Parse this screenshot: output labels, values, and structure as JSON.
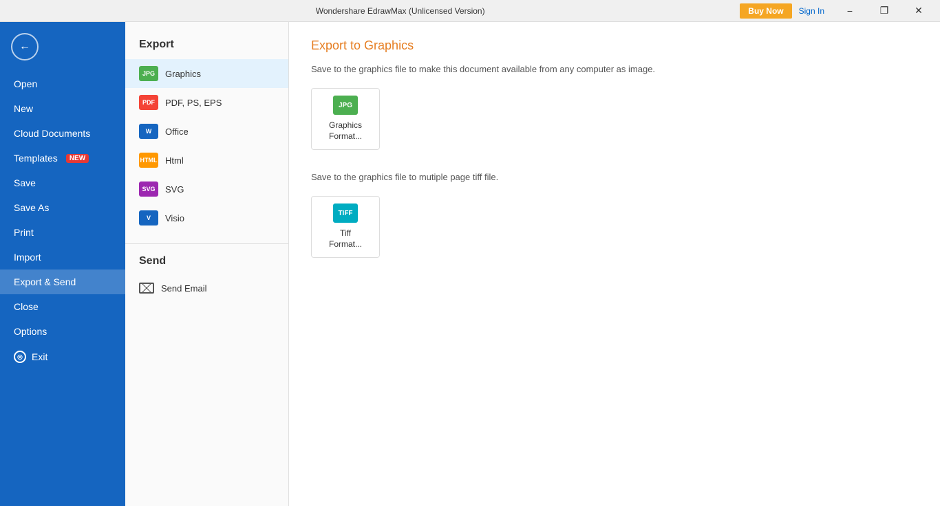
{
  "titlebar": {
    "title": "Wondershare EdrawMax (Unlicensed Version)",
    "buy_now": "Buy Now",
    "sign_in": "Sign In",
    "minimize": "−",
    "restore": "❐",
    "close": "✕"
  },
  "sidebar": {
    "items": [
      {
        "id": "open",
        "label": "Open",
        "badge": null
      },
      {
        "id": "new",
        "label": "New",
        "badge": null
      },
      {
        "id": "cloud-documents",
        "label": "Cloud Documents",
        "badge": null
      },
      {
        "id": "templates",
        "label": "Templates",
        "badge": "NEW"
      },
      {
        "id": "save",
        "label": "Save",
        "badge": null
      },
      {
        "id": "save-as",
        "label": "Save As",
        "badge": null
      },
      {
        "id": "print",
        "label": "Print",
        "badge": null
      },
      {
        "id": "import",
        "label": "Import",
        "badge": null
      },
      {
        "id": "export-send",
        "label": "Export & Send",
        "badge": null,
        "active": true
      },
      {
        "id": "close",
        "label": "Close",
        "badge": null
      },
      {
        "id": "options",
        "label": "Options",
        "badge": null
      },
      {
        "id": "exit",
        "label": "Exit",
        "badge": null
      }
    ]
  },
  "middle": {
    "export_section": "Export",
    "menu_items": [
      {
        "id": "graphics",
        "label": "Graphics",
        "fmt": "jpg",
        "fmt_label": "JPG",
        "active": true
      },
      {
        "id": "pdf",
        "label": "PDF, PS, EPS",
        "fmt": "pdf",
        "fmt_label": "PDF"
      },
      {
        "id": "office",
        "label": "Office",
        "fmt": "word",
        "fmt_label": "W"
      },
      {
        "id": "html",
        "label": "Html",
        "fmt": "html",
        "fmt_label": "HTML"
      },
      {
        "id": "svg",
        "label": "SVG",
        "fmt": "svg",
        "fmt_label": "SVG"
      },
      {
        "id": "visio",
        "label": "Visio",
        "fmt": "visio",
        "fmt_label": "V"
      }
    ],
    "send_section": "Send",
    "send_items": [
      {
        "id": "send-email",
        "label": "Send Email"
      }
    ]
  },
  "content": {
    "heading": "Export to Graphics",
    "desc1": "Save to the graphics file to make this document available from any computer as image.",
    "cards1": [
      {
        "id": "graphics-format",
        "icon_label": "JPG",
        "icon_class": "card-icon-jpg",
        "label": "Graphics\nFormat..."
      }
    ],
    "desc2": "Save to the graphics file to mutiple page tiff file.",
    "cards2": [
      {
        "id": "tiff-format",
        "icon_label": "TIFF",
        "icon_class": "card-icon-tiff",
        "label": "Tiff\nFormat..."
      }
    ]
  }
}
